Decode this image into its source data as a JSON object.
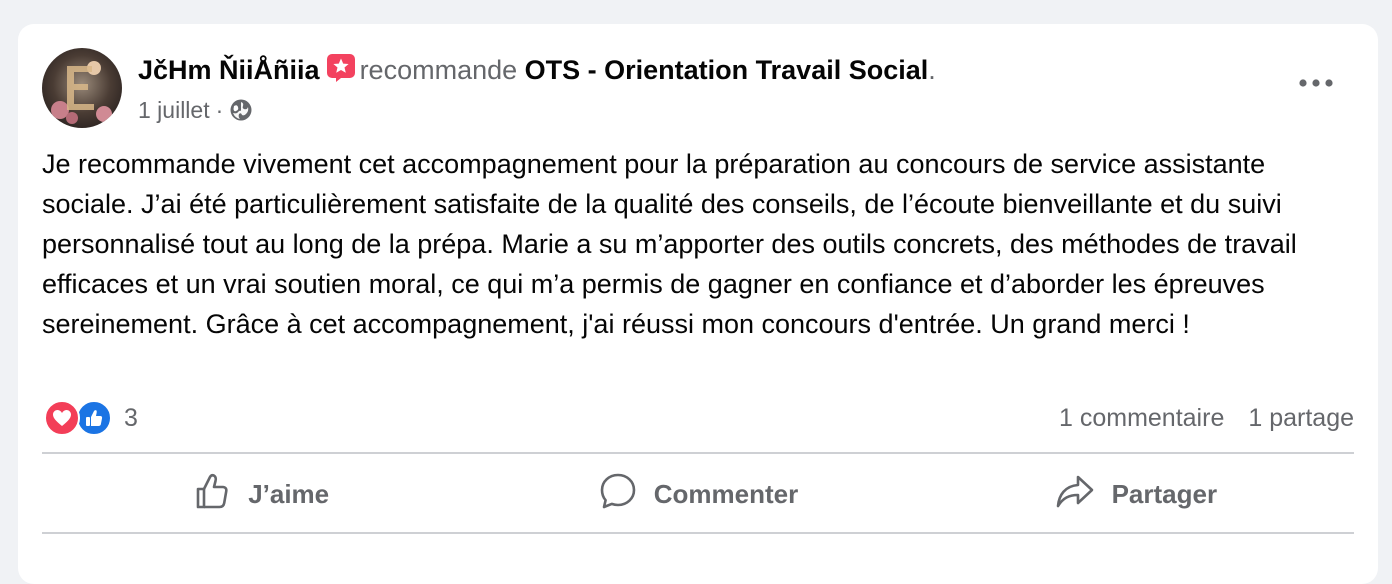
{
  "post": {
    "author": "JčHm ŇiiÅñiia",
    "verb": "recommande",
    "page": "OTS - Orientation Travail Social",
    "period": ".",
    "date": "1 juillet",
    "separator": "·",
    "body": "Je recommande vivement cet accompagnement pour la préparation au concours de service assistante sociale. J’ai été particulièrement satisfaite de la qualité des conseils, de l’écoute bienveillante et du suivi personnalisé tout au long de la prépa. Marie a su m’apporter des outils concrets, des méthodes de travail efficaces et un vrai soutien moral, ce qui m’a permis de gagner en confiance et d’aborder les épreuves sereinement. Grâce à cet accompagnement, j'ai réussi mon concours d'entrée. Un grand merci !"
  },
  "engagement": {
    "reaction_count": "3",
    "comments": "1 commentaire",
    "shares": "1 partage"
  },
  "actions": {
    "like": "J’aime",
    "comment": "Commenter",
    "share": "Partager"
  },
  "icons": {
    "recommend_badge": "recommend-star-icon",
    "privacy": "globe-icon",
    "more": "more-options-icon",
    "reaction_love": "love-reaction-icon",
    "reaction_like": "like-reaction-icon"
  },
  "colors": {
    "recommend_badge": "#f3425f",
    "love": "#f33e58",
    "like": "#1b74e4",
    "secondary_text": "#65676b"
  }
}
